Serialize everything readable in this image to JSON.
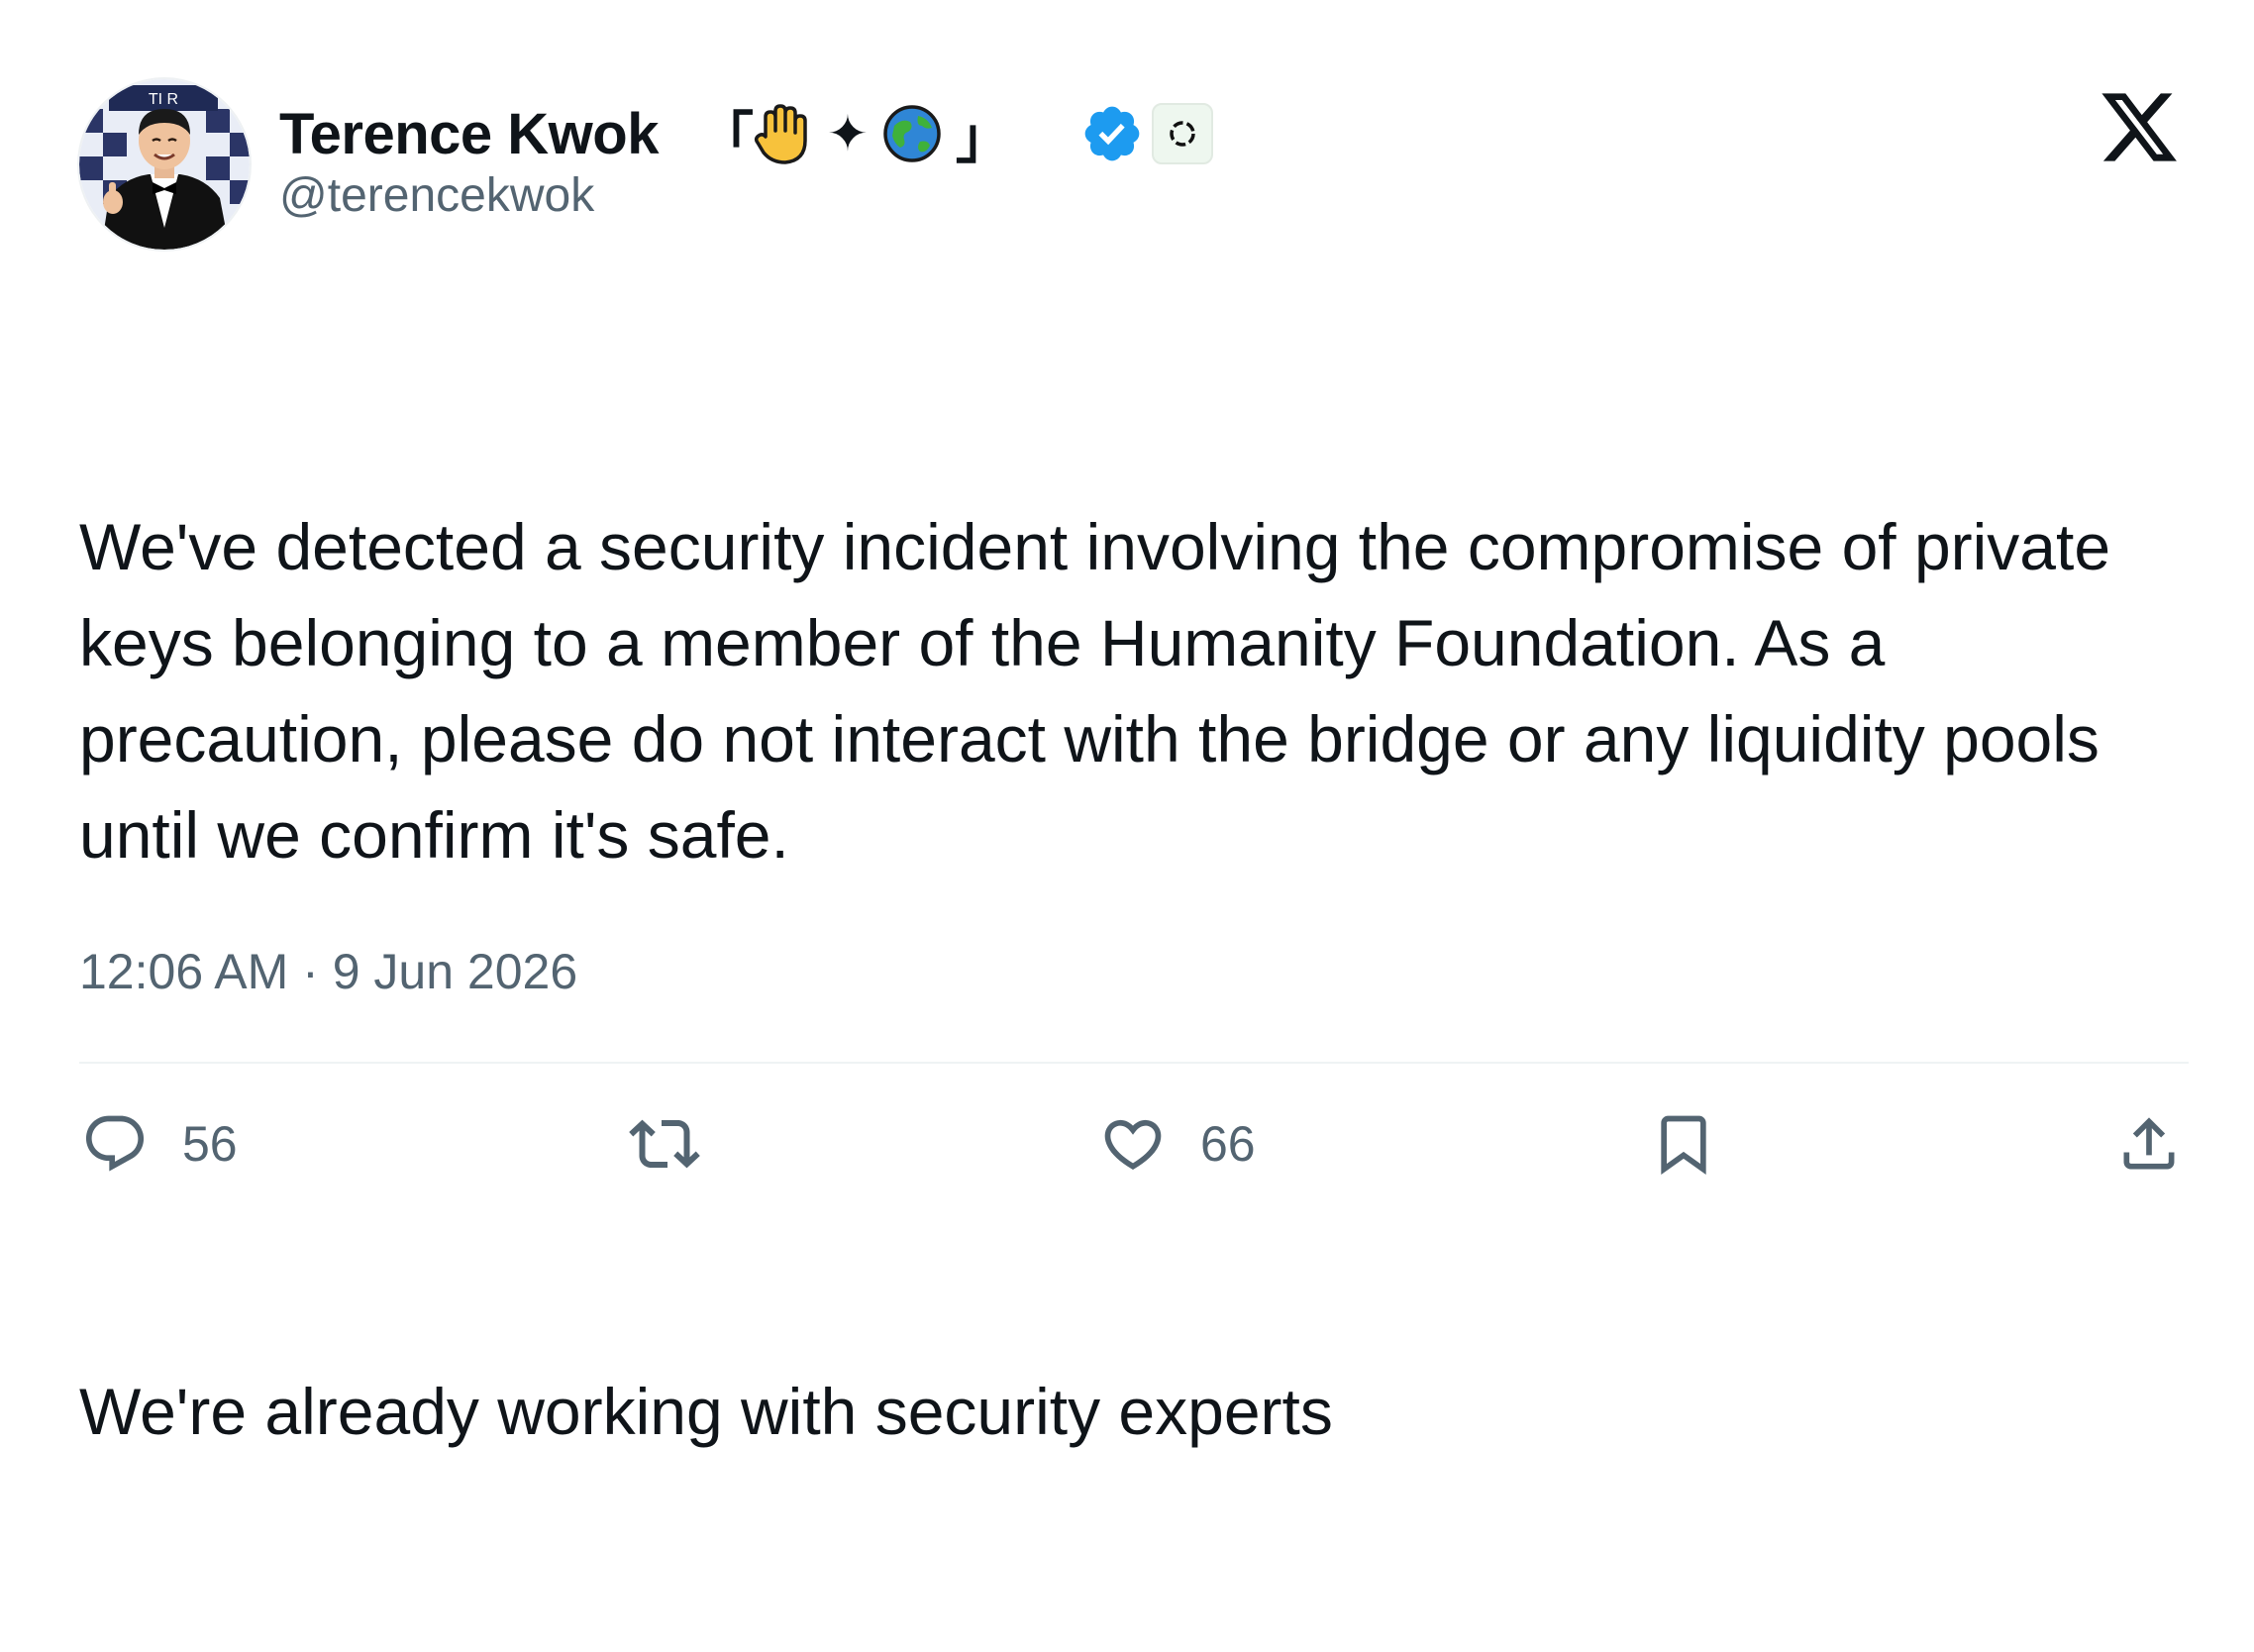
{
  "author": {
    "display_name": "Terence Kwok",
    "name_decoration": {
      "open_bracket": "「",
      "emoji_hand": "🖐",
      "sparkle": "✦",
      "emoji_globe": "🌏",
      "close_bracket": "」"
    },
    "handle": "@terencekwok",
    "avatar_sign_text": "TI  R",
    "verified_color": "#1d9bf0"
  },
  "tweet": {
    "paragraphs": [
      "We've detected a security incident involving the compromise of private keys belonging to a member of the Humanity Foundation. As a precaution, please do not interact with the bridge or any liquidity pools until we confirm it's safe.",
      "We're already working with security experts"
    ],
    "timestamp": "12:06 AM · 9 Jun 2026"
  },
  "actions": {
    "reply_count": "56",
    "like_count": "66",
    "icons": [
      "reply-icon",
      "retweet-icon",
      "like-icon",
      "bookmark-icon",
      "share-icon"
    ]
  },
  "colors": {
    "text": "#0f1419",
    "secondary": "#536471",
    "divider": "#eff3f4",
    "verified": "#1d9bf0"
  }
}
